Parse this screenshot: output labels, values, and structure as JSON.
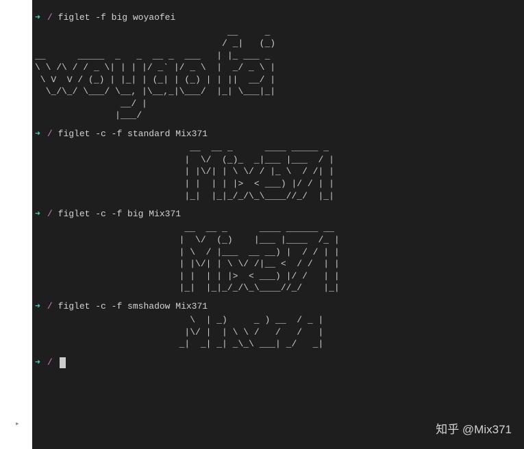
{
  "prompt": {
    "arrow": "➜",
    "path": "/"
  },
  "commands": [
    {
      "cmd": "figlet -f big woyaofei",
      "output": "                                    __     _ \n                                   / _|   (_)\n__      _____  _   _  __ _  ___   | |_ ___ _ \n\\ \\ /\\ / / _ \\| | | |/ _` |/ _ \\  |  _/ _ \\ |\n \\ V  V / (_) | |_| | (_| | (_) | | ||  __/ |\n  \\_/\\_/ \\___/ \\__, |\\__,_|\\___/  |_| \\___|_|\n                __/ |                        \n               |___/                         "
    },
    {
      "cmd": "figlet -c -f standard Mix371",
      "output": "                             __  __ _      ____ _____ _ \n                            |  \\/  (_)_  _|___ |___  / |\n                            | |\\/| | \\ \\/ / |_ \\  / /| |\n                            | |  | | |>  < ___) |/ / | |\n                            |_|  |_|_/_/\\_\\____//_/  |_|"
    },
    {
      "cmd": "figlet -c -f big Mix371",
      "output": "                            __  __ _      ____ ______ __ \n                           |  \\/  (_)    |___ |____  /_ |\n                           | \\  / |___  __ __) |  / / | |\n                           | |\\/| | \\ \\/ /|__ <  / /  | |\n                           | |  | | |>  < ___) |/ /   | |\n                           |_|  |_|_/_/\\_\\____//_/    |_|"
    },
    {
      "cmd": "figlet -c -f smshadow Mix371",
      "output": "                             \\  | _)     _ ) __  / _ | \n                            |\\/ |  | \\ \\ /   /   /   | \n                           _|  _| _| _\\_\\ ___| _/   _| "
    },
    {
      "cmd": "",
      "output": ""
    }
  ],
  "watermark": "知乎 @Mix371",
  "gutter_arrow": "▸"
}
